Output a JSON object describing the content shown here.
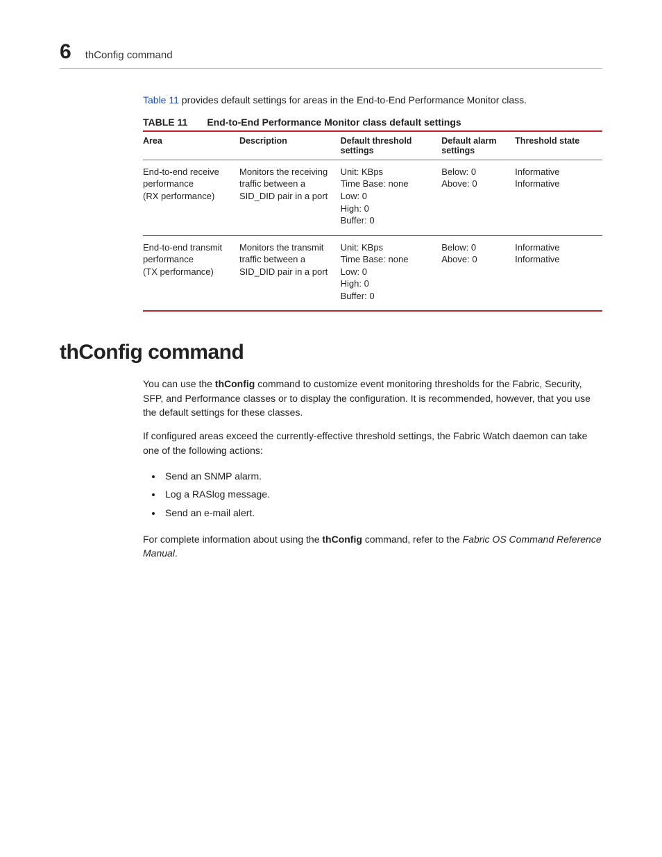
{
  "header": {
    "chapter_number": "6",
    "running_title": "thConfig command"
  },
  "intro": {
    "link_text": "Table 11",
    "rest": " provides default settings for areas in the End-to-End Performance Monitor class."
  },
  "table": {
    "label": "TABLE 11",
    "title": "End-to-End Performance Monitor class default settings",
    "headers": {
      "area": "Area",
      "description": "Description",
      "threshold": "Default threshold settings",
      "alarm": "Default alarm settings",
      "state": "Threshold state"
    },
    "rows": [
      {
        "area": "End-to-end receive performance\n(RX performance)",
        "description": "Monitors the receiving traffic between a SID_DID pair in a port",
        "threshold": "Unit: KBps\nTime Base: none\nLow: 0\nHigh: 0\nBuffer: 0",
        "alarm": "Below: 0\nAbove: 0",
        "state": "Informative\nInformative"
      },
      {
        "area": "End-to-end transmit performance\n(TX performance)",
        "description": "Monitors the transmit traffic between a SID_DID pair in a port",
        "threshold": "Unit: KBps\nTime Base: none\nLow: 0\nHigh: 0\nBuffer: 0",
        "alarm": "Below: 0\nAbove: 0",
        "state": "Informative\nInformative"
      }
    ]
  },
  "section": {
    "heading": "thConfig command",
    "para1_a": "You can use the ",
    "para1_bold": "thConfig",
    "para1_b": " command to customize event monitoring thresholds for the Fabric, Security, SFP, and Performance classes or to display the configuration. It is recommended, however, that you use the default settings for these classes.",
    "para2": "If configured areas exceed the currently-effective threshold settings, the Fabric Watch daemon can take one of the following actions:",
    "bullets": [
      "Send an SNMP alarm.",
      "Log a RASlog message.",
      "Send an e-mail alert."
    ],
    "para3_a": "For complete information about using the ",
    "para3_bold": "thConfig",
    "para3_b": " command, refer to the ",
    "para3_ital": "Fabric OS Command Reference Manual",
    "para3_c": "."
  }
}
